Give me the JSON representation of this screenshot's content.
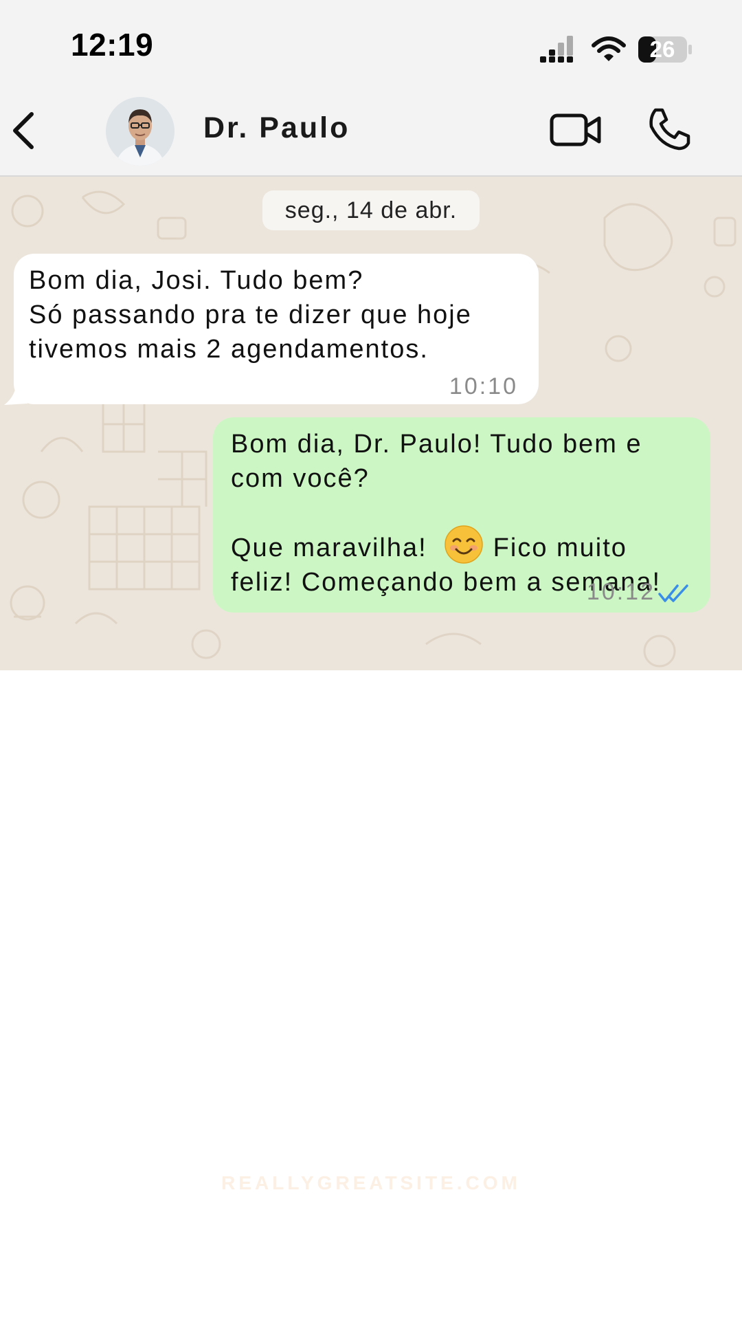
{
  "status_bar": {
    "time": "12:19",
    "battery": "26",
    "icons": [
      "signal-icon",
      "wifi-icon",
      "battery-icon"
    ]
  },
  "header": {
    "contact_name": "Dr. Paulo",
    "icons": [
      "back-arrow-icon",
      "video-camera-icon",
      "phone-icon"
    ]
  },
  "chat": {
    "date": "seg., 14 de abr.",
    "messages": [
      {
        "direction": "incoming",
        "lines": [
          "Bom dia, Josi. Tudo bem?",
          "Só passando pra te dizer que hoje",
          "tivemos mais 2 agendamentos."
        ],
        "time": "10:10"
      },
      {
        "direction": "outgoing",
        "paragraph1": [
          "Bom dia, Dr. Paulo! Tudo bem e",
          "com você?"
        ],
        "line3_before_emoji": "Que maravilha!",
        "emoji": "smiling-face-icon",
        "line3_after_emoji": "Fico muito",
        "line4": "feliz! Começando bem a semana!",
        "time": "10:12",
        "status_icon": "double-check-icon"
      }
    ]
  },
  "watermark": "REALLYGREATSITE.COM",
  "colors": {
    "outgoing_bubble": "#ccf7c4",
    "incoming_bubble": "#ffffff",
    "chat_wallpaper": "#ece5dc",
    "read_ticks": "#3b8ee8"
  }
}
